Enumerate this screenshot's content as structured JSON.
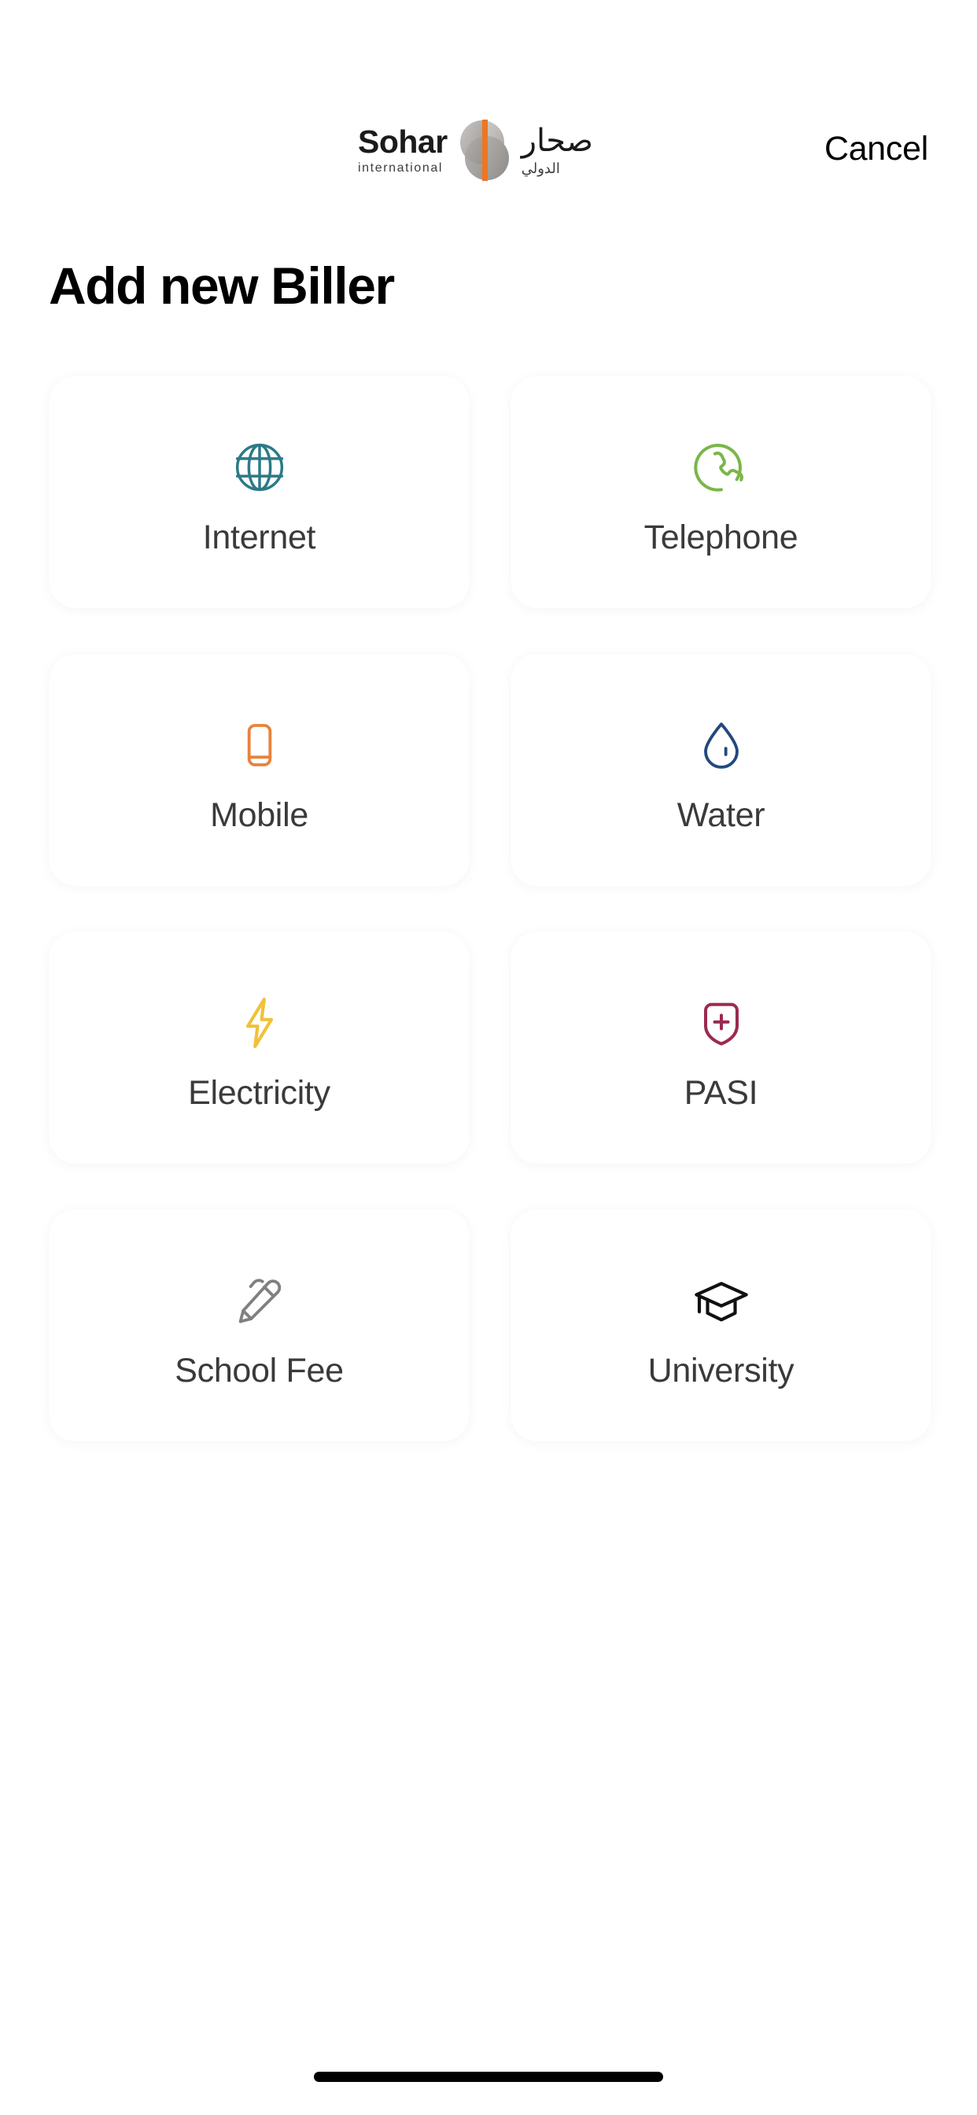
{
  "header": {
    "brand": {
      "latin_main": "Sohar",
      "latin_sub": "international",
      "arabic_main": "صحار",
      "arabic_sub": "الدولي",
      "mark_icon": "sohar-split-circle-logo-mark",
      "mark_gray_light": "#B8B5B2",
      "mark_gray_dark": "#9C9996",
      "mark_accent": "#EE7623"
    },
    "cancel_label": "Cancel"
  },
  "page": {
    "title": "Add new Biller",
    "background": "#FFFFFF",
    "card_background": "#FFFFFF",
    "label_color": "#3A3A3A"
  },
  "billers": [
    {
      "label": "Internet",
      "icon": "globe-icon",
      "color": "#2C7A87"
    },
    {
      "label": "Telephone",
      "icon": "phone-handset-circle-icon",
      "color": "#7AB648"
    },
    {
      "label": "Mobile",
      "icon": "mobile-phone-icon",
      "color": "#E8823C"
    },
    {
      "label": "Water",
      "icon": "water-droplet-icon",
      "color": "#23497D"
    },
    {
      "label": "Electricity",
      "icon": "lightning-bolt-icon",
      "color": "#F0C13A"
    },
    {
      "label": "PASI",
      "icon": "shield-plus-icon",
      "color": "#9B2A52"
    },
    {
      "label": "School Fee",
      "icon": "pencil-icon",
      "color": "#808080"
    },
    {
      "label": "University",
      "icon": "graduation-cap-icon",
      "color": "#111111"
    }
  ],
  "system": {
    "home_indicator": "home-indicator-bar"
  }
}
